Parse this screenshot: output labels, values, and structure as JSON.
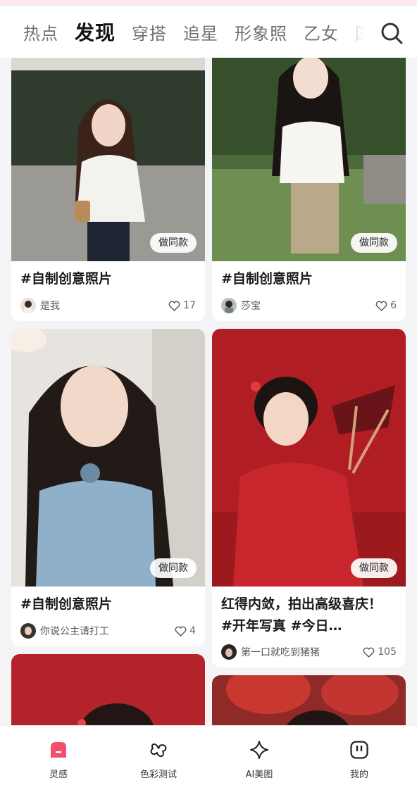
{
  "colors": {
    "accent": "#f0506e",
    "card_bg": "#ffffff",
    "page_bg": "#f4f3f5"
  },
  "tabs": [
    {
      "label": "热点",
      "active": false
    },
    {
      "label": "发现",
      "active": true
    },
    {
      "label": "穿搭",
      "active": false
    },
    {
      "label": "追星",
      "active": false
    },
    {
      "label": "形象照",
      "active": false
    },
    {
      "label": "乙女",
      "active": false
    },
    {
      "label": "国风",
      "active": false
    }
  ],
  "header": {
    "search_icon": "search-icon"
  },
  "cards": [
    {
      "title": "#自制创意照片",
      "author": "是我",
      "likes": "17",
      "action": "做同款"
    },
    {
      "title": "#自制创意照片",
      "author": "莎宝",
      "likes": "6",
      "action": "做同款"
    },
    {
      "title": "#自制创意照片",
      "author": "你说公主请打工",
      "likes": "4",
      "action": "做同款"
    },
    {
      "title": "红得内敛，拍出高级喜庆！ #开年写真 #今日…",
      "author": "第一口就吃到猪猪",
      "likes": "105",
      "action": "做同款"
    }
  ],
  "bottom_nav": [
    {
      "label": "灵感",
      "icon": "inspiration-icon",
      "active": true
    },
    {
      "label": "色彩测试",
      "icon": "color-test-icon",
      "active": false
    },
    {
      "label": "AI美图",
      "icon": "sparkle-icon",
      "active": false
    },
    {
      "label": "我的",
      "icon": "profile-icon",
      "active": false
    }
  ]
}
